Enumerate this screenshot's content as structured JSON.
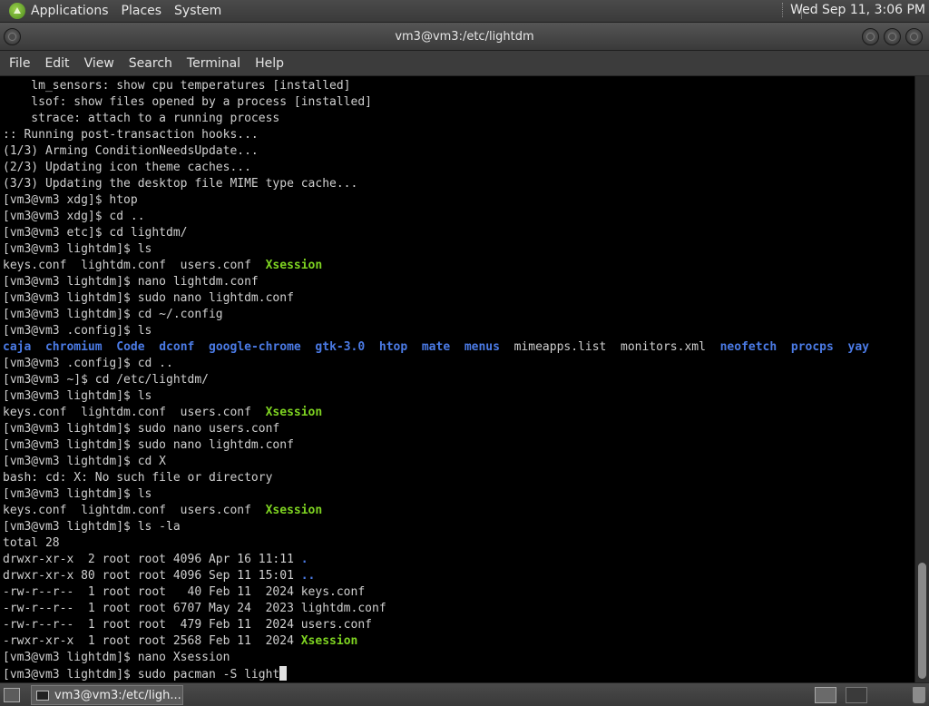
{
  "top_panel": {
    "menus": [
      "Applications",
      "Places",
      "System"
    ],
    "clock": "Wed Sep 11,  3:06 PM"
  },
  "window": {
    "title": "vm3@vm3:/etc/lightdm",
    "menu": [
      "File",
      "Edit",
      "View",
      "Search",
      "Terminal",
      "Help"
    ]
  },
  "terminal": {
    "lines": [
      [
        {
          "t": "    lm_sensors: show cpu temperatures [installed]"
        }
      ],
      [
        {
          "t": "    lsof: show files opened by a process [installed]"
        }
      ],
      [
        {
          "t": "    strace: attach to a running process"
        }
      ],
      [
        {
          "t": ":: Running post-transaction hooks..."
        }
      ],
      [
        {
          "t": "(1/3) Arming ConditionNeedsUpdate..."
        }
      ],
      [
        {
          "t": "(2/3) Updating icon theme caches..."
        }
      ],
      [
        {
          "t": "(3/3) Updating the desktop file MIME type cache..."
        }
      ],
      [
        {
          "t": "[vm3@vm3 xdg]$ htop"
        }
      ],
      [
        {
          "t": "[vm3@vm3 xdg]$ cd .."
        }
      ],
      [
        {
          "t": "[vm3@vm3 etc]$ cd lightdm/"
        }
      ],
      [
        {
          "t": "[vm3@vm3 lightdm]$ ls"
        }
      ],
      [
        {
          "t": "keys.conf  lightdm.conf  users.conf  "
        },
        {
          "t": "Xsession",
          "c": "exec"
        }
      ],
      [
        {
          "t": "[vm3@vm3 lightdm]$ nano lightdm.conf"
        }
      ],
      [
        {
          "t": "[vm3@vm3 lightdm]$ sudo nano lightdm.conf"
        }
      ],
      [
        {
          "t": "[vm3@vm3 lightdm]$ cd ~/.config"
        }
      ],
      [
        {
          "t": "[vm3@vm3 .config]$ ls"
        }
      ],
      [
        {
          "t": "caja",
          "c": "dir"
        },
        {
          "t": "  "
        },
        {
          "t": "chromium",
          "c": "dir"
        },
        {
          "t": "  "
        },
        {
          "t": "Code",
          "c": "dir"
        },
        {
          "t": "  "
        },
        {
          "t": "dconf",
          "c": "dir"
        },
        {
          "t": "  "
        },
        {
          "t": "google-chrome",
          "c": "dir"
        },
        {
          "t": "  "
        },
        {
          "t": "gtk-3.0",
          "c": "dir"
        },
        {
          "t": "  "
        },
        {
          "t": "htop",
          "c": "dir"
        },
        {
          "t": "  "
        },
        {
          "t": "mate",
          "c": "dir"
        },
        {
          "t": "  "
        },
        {
          "t": "menus",
          "c": "dir"
        },
        {
          "t": "  mimeapps.list  monitors.xml  "
        },
        {
          "t": "neofetch",
          "c": "dir"
        },
        {
          "t": "  "
        },
        {
          "t": "procps",
          "c": "dir"
        },
        {
          "t": "  "
        },
        {
          "t": "yay",
          "c": "dir"
        }
      ],
      [
        {
          "t": "[vm3@vm3 .config]$ cd .."
        }
      ],
      [
        {
          "t": "[vm3@vm3 ~]$ cd /etc/lightdm/"
        }
      ],
      [
        {
          "t": "[vm3@vm3 lightdm]$ ls"
        }
      ],
      [
        {
          "t": "keys.conf  lightdm.conf  users.conf  "
        },
        {
          "t": "Xsession",
          "c": "exec"
        }
      ],
      [
        {
          "t": "[vm3@vm3 lightdm]$ sudo nano users.conf"
        }
      ],
      [
        {
          "t": "[vm3@vm3 lightdm]$ sudo nano lightdm.conf"
        }
      ],
      [
        {
          "t": "[vm3@vm3 lightdm]$ cd X"
        }
      ],
      [
        {
          "t": "bash: cd: X: No such file or directory"
        }
      ],
      [
        {
          "t": "[vm3@vm3 lightdm]$ ls"
        }
      ],
      [
        {
          "t": "keys.conf  lightdm.conf  users.conf  "
        },
        {
          "t": "Xsession",
          "c": "exec"
        }
      ],
      [
        {
          "t": "[vm3@vm3 lightdm]$ ls -la"
        }
      ],
      [
        {
          "t": "total 28"
        }
      ],
      [
        {
          "t": "drwxr-xr-x  2 root root 4096 Apr 16 11:11 "
        },
        {
          "t": ".",
          "c": "dir"
        }
      ],
      [
        {
          "t": "drwxr-xr-x 80 root root 4096 Sep 11 15:01 "
        },
        {
          "t": "..",
          "c": "dir"
        }
      ],
      [
        {
          "t": "-rw-r--r--  1 root root   40 Feb 11  2024 keys.conf"
        }
      ],
      [
        {
          "t": "-rw-r--r--  1 root root 6707 May 24  2023 lightdm.conf"
        }
      ],
      [
        {
          "t": "-rw-r--r--  1 root root  479 Feb 11  2024 users.conf"
        }
      ],
      [
        {
          "t": "-rwxr-xr-x  1 root root 2568 Feb 11  2024 "
        },
        {
          "t": "Xsession",
          "c": "exec"
        }
      ],
      [
        {
          "t": "[vm3@vm3 lightdm]$ nano Xsession"
        }
      ],
      [
        {
          "t": "[vm3@vm3 lightdm]$ sudo pacman -S light"
        }
      ]
    ]
  },
  "taskbar": {
    "task_label": "vm3@vm3:/etc/ligh..."
  },
  "colors": {
    "dir": "#4b7be6",
    "exec": "#7ed321",
    "text": "#cfcfcf"
  }
}
